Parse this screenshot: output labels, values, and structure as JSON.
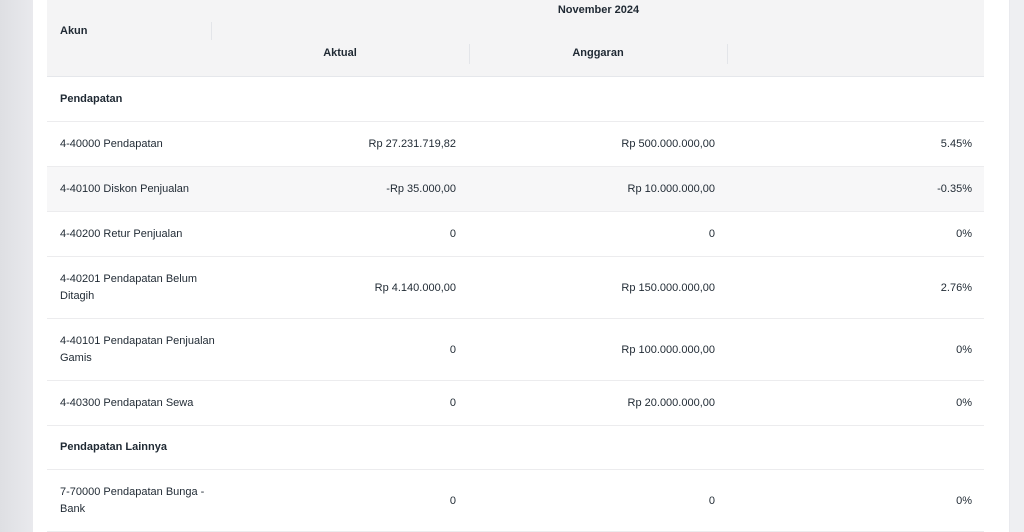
{
  "header": {
    "account_label": "Akun",
    "period": "November 2024",
    "actual_label": "Aktual",
    "budget_label": "Anggaran"
  },
  "sections": [
    {
      "title": "Pendapatan",
      "rows": [
        {
          "account": "4-40000 Pendapatan",
          "actual": "Rp 27.231.719,82",
          "budget": "Rp 500.000.000,00",
          "percent": "5.45%"
        },
        {
          "account": "4-40100 Diskon Penjualan",
          "actual": "-Rp 35.000,00",
          "budget": "Rp 10.000.000,00",
          "percent": "-0.35%"
        },
        {
          "account": "4-40200 Retur Penjualan",
          "actual": "0",
          "budget": "0",
          "percent": "0%"
        },
        {
          "account": "4-40201 Pendapatan Belum Ditagih",
          "actual": "Rp 4.140.000,00",
          "budget": "Rp 150.000.000,00",
          "percent": "2.76%"
        },
        {
          "account": "4-40101 Pendapatan Penjualan Gamis",
          "actual": "0",
          "budget": "Rp 100.000.000,00",
          "percent": "0%"
        },
        {
          "account": "4-40300 Pendapatan Sewa",
          "actual": "0",
          "budget": "Rp 20.000.000,00",
          "percent": "0%"
        }
      ]
    },
    {
      "title": "Pendapatan Lainnya",
      "rows": [
        {
          "account": "7-70000 Pendapatan Bunga - Bank",
          "actual": "0",
          "budget": "0",
          "percent": "0%"
        }
      ]
    }
  ]
}
